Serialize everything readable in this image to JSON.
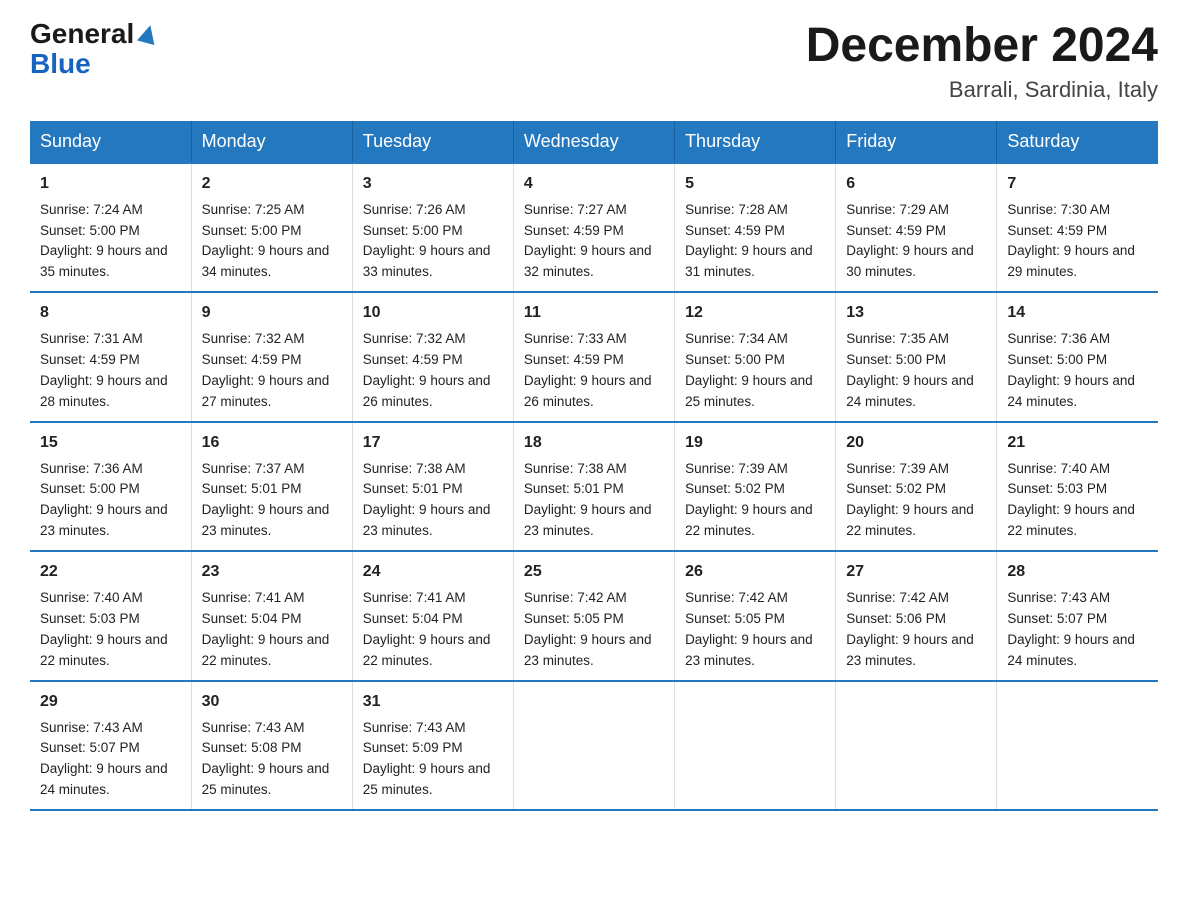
{
  "logo": {
    "text1": "General",
    "text2": "Blue"
  },
  "header": {
    "month": "December 2024",
    "location": "Barrali, Sardinia, Italy"
  },
  "days": [
    "Sunday",
    "Monday",
    "Tuesday",
    "Wednesday",
    "Thursday",
    "Friday",
    "Saturday"
  ],
  "weeks": [
    [
      {
        "num": "1",
        "sunrise": "7:24 AM",
        "sunset": "5:00 PM",
        "daylight": "9 hours and 35 minutes."
      },
      {
        "num": "2",
        "sunrise": "7:25 AM",
        "sunset": "5:00 PM",
        "daylight": "9 hours and 34 minutes."
      },
      {
        "num": "3",
        "sunrise": "7:26 AM",
        "sunset": "5:00 PM",
        "daylight": "9 hours and 33 minutes."
      },
      {
        "num": "4",
        "sunrise": "7:27 AM",
        "sunset": "4:59 PM",
        "daylight": "9 hours and 32 minutes."
      },
      {
        "num": "5",
        "sunrise": "7:28 AM",
        "sunset": "4:59 PM",
        "daylight": "9 hours and 31 minutes."
      },
      {
        "num": "6",
        "sunrise": "7:29 AM",
        "sunset": "4:59 PM",
        "daylight": "9 hours and 30 minutes."
      },
      {
        "num": "7",
        "sunrise": "7:30 AM",
        "sunset": "4:59 PM",
        "daylight": "9 hours and 29 minutes."
      }
    ],
    [
      {
        "num": "8",
        "sunrise": "7:31 AM",
        "sunset": "4:59 PM",
        "daylight": "9 hours and 28 minutes."
      },
      {
        "num": "9",
        "sunrise": "7:32 AM",
        "sunset": "4:59 PM",
        "daylight": "9 hours and 27 minutes."
      },
      {
        "num": "10",
        "sunrise": "7:32 AM",
        "sunset": "4:59 PM",
        "daylight": "9 hours and 26 minutes."
      },
      {
        "num": "11",
        "sunrise": "7:33 AM",
        "sunset": "4:59 PM",
        "daylight": "9 hours and 26 minutes."
      },
      {
        "num": "12",
        "sunrise": "7:34 AM",
        "sunset": "5:00 PM",
        "daylight": "9 hours and 25 minutes."
      },
      {
        "num": "13",
        "sunrise": "7:35 AM",
        "sunset": "5:00 PM",
        "daylight": "9 hours and 24 minutes."
      },
      {
        "num": "14",
        "sunrise": "7:36 AM",
        "sunset": "5:00 PM",
        "daylight": "9 hours and 24 minutes."
      }
    ],
    [
      {
        "num": "15",
        "sunrise": "7:36 AM",
        "sunset": "5:00 PM",
        "daylight": "9 hours and 23 minutes."
      },
      {
        "num": "16",
        "sunrise": "7:37 AM",
        "sunset": "5:01 PM",
        "daylight": "9 hours and 23 minutes."
      },
      {
        "num": "17",
        "sunrise": "7:38 AM",
        "sunset": "5:01 PM",
        "daylight": "9 hours and 23 minutes."
      },
      {
        "num": "18",
        "sunrise": "7:38 AM",
        "sunset": "5:01 PM",
        "daylight": "9 hours and 23 minutes."
      },
      {
        "num": "19",
        "sunrise": "7:39 AM",
        "sunset": "5:02 PM",
        "daylight": "9 hours and 22 minutes."
      },
      {
        "num": "20",
        "sunrise": "7:39 AM",
        "sunset": "5:02 PM",
        "daylight": "9 hours and 22 minutes."
      },
      {
        "num": "21",
        "sunrise": "7:40 AM",
        "sunset": "5:03 PM",
        "daylight": "9 hours and 22 minutes."
      }
    ],
    [
      {
        "num": "22",
        "sunrise": "7:40 AM",
        "sunset": "5:03 PM",
        "daylight": "9 hours and 22 minutes."
      },
      {
        "num": "23",
        "sunrise": "7:41 AM",
        "sunset": "5:04 PM",
        "daylight": "9 hours and 22 minutes."
      },
      {
        "num": "24",
        "sunrise": "7:41 AM",
        "sunset": "5:04 PM",
        "daylight": "9 hours and 22 minutes."
      },
      {
        "num": "25",
        "sunrise": "7:42 AM",
        "sunset": "5:05 PM",
        "daylight": "9 hours and 23 minutes."
      },
      {
        "num": "26",
        "sunrise": "7:42 AM",
        "sunset": "5:05 PM",
        "daylight": "9 hours and 23 minutes."
      },
      {
        "num": "27",
        "sunrise": "7:42 AM",
        "sunset": "5:06 PM",
        "daylight": "9 hours and 23 minutes."
      },
      {
        "num": "28",
        "sunrise": "7:43 AM",
        "sunset": "5:07 PM",
        "daylight": "9 hours and 24 minutes."
      }
    ],
    [
      {
        "num": "29",
        "sunrise": "7:43 AM",
        "sunset": "5:07 PM",
        "daylight": "9 hours and 24 minutes."
      },
      {
        "num": "30",
        "sunrise": "7:43 AM",
        "sunset": "5:08 PM",
        "daylight": "9 hours and 25 minutes."
      },
      {
        "num": "31",
        "sunrise": "7:43 AM",
        "sunset": "5:09 PM",
        "daylight": "9 hours and 25 minutes."
      },
      null,
      null,
      null,
      null
    ]
  ]
}
